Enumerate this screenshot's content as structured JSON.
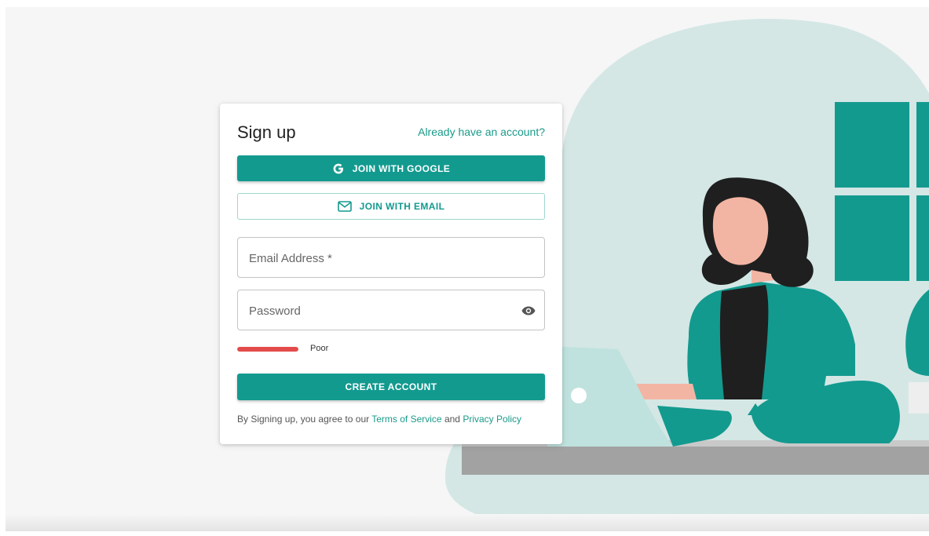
{
  "signup_card": {
    "title": "Sign up",
    "login_link": "Already have an account?",
    "google_button": "JOIN WITH GOOGLE",
    "email_button": "JOIN WITH EMAIL",
    "email_field": {
      "placeholder": "Email Address *",
      "value": ""
    },
    "password_field": {
      "placeholder": "Password",
      "value": ""
    },
    "password_strength": {
      "label": "Poor",
      "level": 1.0
    },
    "create_button": "CREATE ACCOUNT",
    "legal": {
      "prefix": "By Signing up, you agree to our",
      "terms_link": "Terms of Service",
      "conjunction": "and",
      "privacy_link": "Privacy Policy"
    }
  },
  "icons": {
    "google": "google-g-icon",
    "email": "mail-envelope-icon",
    "password_toggle": "eye-icon"
  },
  "colors": {
    "accent": "#139a8f",
    "blob": "#d4e7e5",
    "strength_poor": "#e34a4a"
  }
}
